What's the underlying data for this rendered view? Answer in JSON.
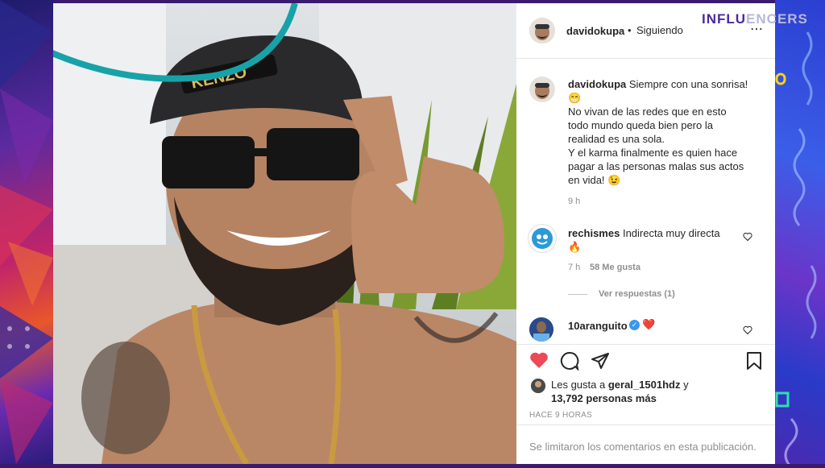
{
  "logo": {
    "text_a": "INFLU",
    "text_b": "ENCERS"
  },
  "post": {
    "header": {
      "username": "davidokupa",
      "separator": "•",
      "follow_status": "Siguiendo"
    },
    "caption": {
      "username": "davidokupa",
      "line1": "Siempre con una sonrisa!",
      "emoji1": "😁",
      "body": [
        "No vivan de las redes que en esto",
        "todo mundo queda bien pero la",
        "realidad es una sola.",
        "Y el karma finalmente es quien hace",
        "pagar a las personas malas sus actos",
        "en vida!"
      ],
      "emoji2": "😉",
      "time": "9 h"
    },
    "comments": [
      {
        "username": "rechismes",
        "text": "Indirecta muy directa",
        "emoji": "🔥",
        "time": "7 h",
        "likes": "58 Me gusta",
        "replies": "Ver respuestas (1)"
      },
      {
        "username": "10aranguito",
        "emoji": "❤️"
      }
    ],
    "likes": {
      "prefix": "Les gusta a",
      "user": "geral_1501hdz",
      "connector": "y",
      "count": "13,792 personas más"
    },
    "date": "HACE 9 HORAS",
    "comment_notice": "Se limitaron los comentarios en esta publicación.",
    "colors": {
      "like_heart": "#ed4956",
      "verified": "#3897f0",
      "icon": "#262626"
    }
  }
}
